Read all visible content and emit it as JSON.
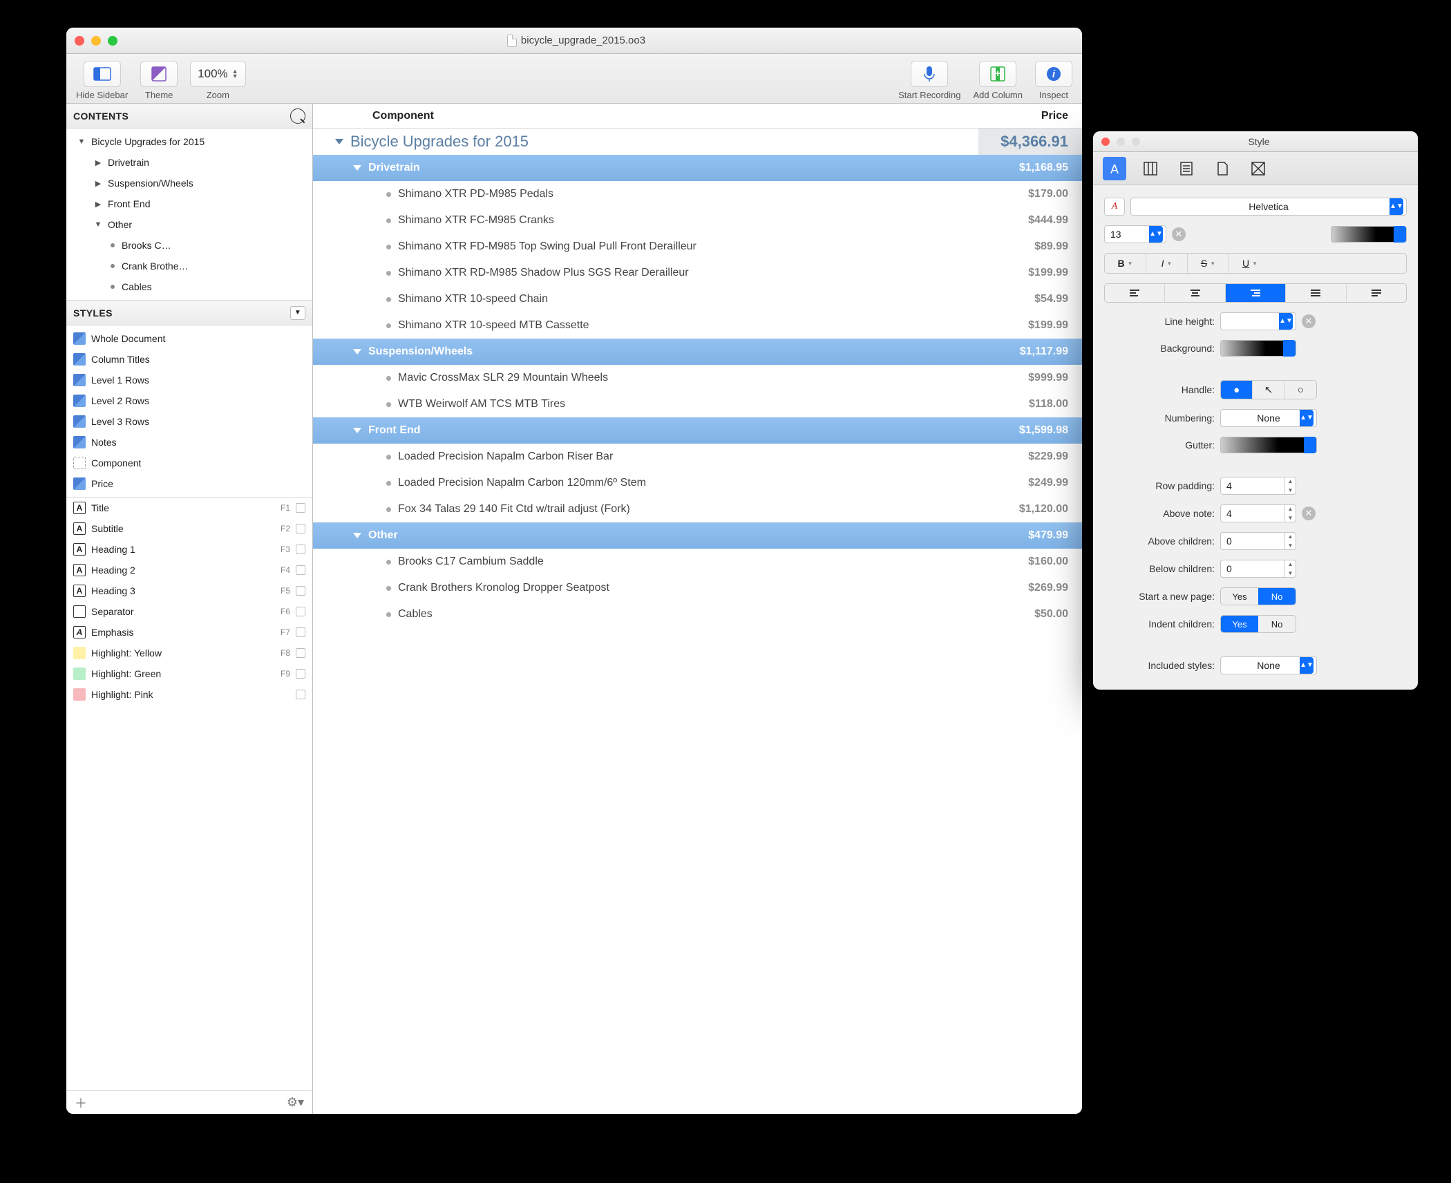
{
  "window": {
    "title": "bicycle_upgrade_2015.oo3"
  },
  "toolbar": {
    "hide_sidebar": "Hide Sidebar",
    "theme": "Theme",
    "zoom_label": "Zoom",
    "zoom_value": "100%",
    "start_recording": "Start Recording",
    "add_column": "Add Column",
    "inspect": "Inspect"
  },
  "sidebar": {
    "contents_label": "CONTENTS",
    "styles_label": "STYLES",
    "contents": [
      {
        "label": "Bicycle Upgrades for 2015",
        "indent": 0,
        "expanded": true,
        "leaf": false
      },
      {
        "label": "Drivetrain",
        "indent": 1,
        "expanded": false,
        "leaf": false
      },
      {
        "label": "Suspension/Wheels",
        "indent": 1,
        "expanded": false,
        "leaf": false
      },
      {
        "label": "Front End",
        "indent": 1,
        "expanded": false,
        "leaf": false
      },
      {
        "label": "Other",
        "indent": 1,
        "expanded": true,
        "leaf": false
      },
      {
        "label": "Brooks C…",
        "indent": 2,
        "leaf": true
      },
      {
        "label": "Crank Brothe…",
        "indent": 2,
        "leaf": true
      },
      {
        "label": "Cables",
        "indent": 2,
        "leaf": true
      }
    ],
    "styles": [
      {
        "label": "Whole Document",
        "swatch": "blue"
      },
      {
        "label": "Column Titles",
        "swatch": "blue"
      },
      {
        "label": "Level 1 Rows",
        "swatch": "blue"
      },
      {
        "label": "Level 2 Rows",
        "swatch": "blue"
      },
      {
        "label": "Level 3 Rows",
        "swatch": "blue"
      },
      {
        "label": "Notes",
        "swatch": "blue"
      },
      {
        "label": "Component",
        "swatch": "dash"
      },
      {
        "label": "Price",
        "swatch": "blue"
      }
    ],
    "named_styles": [
      {
        "label": "Title",
        "key": "F1",
        "glyph": "A"
      },
      {
        "label": "Subtitle",
        "key": "F2",
        "glyph": "A"
      },
      {
        "label": "Heading 1",
        "key": "F3",
        "glyph": "A"
      },
      {
        "label": "Heading 2",
        "key": "F4",
        "glyph": "A"
      },
      {
        "label": "Heading 3",
        "key": "F5",
        "glyph": "A"
      },
      {
        "label": "Separator",
        "key": "F6",
        "glyph": "sep"
      },
      {
        "label": "Emphasis",
        "key": "F7",
        "glyph": "Ai"
      },
      {
        "label": "Highlight: Yellow",
        "key": "F8",
        "glyph": "hl",
        "color": "#fff1a6"
      },
      {
        "label": "Highlight: Green",
        "key": "F9",
        "glyph": "hl",
        "color": "#b8efc8"
      },
      {
        "label": "Highlight: Pink",
        "key": "",
        "glyph": "hl",
        "color": "#f7b9bb"
      }
    ]
  },
  "columns": {
    "component": "Component",
    "price": "Price"
  },
  "outline": [
    {
      "level": 0,
      "label": "Bicycle Upgrades for 2015",
      "price": "$4,366.91"
    },
    {
      "level": 1,
      "label": "Drivetrain",
      "price": "$1,168.95"
    },
    {
      "level": 2,
      "label": "Shimano XTR PD-M985 Pedals",
      "price": "$179.00"
    },
    {
      "level": 2,
      "label": "Shimano XTR FC-M985 Cranks",
      "price": "$444.99"
    },
    {
      "level": 2,
      "label": "Shimano XTR FD-M985 Top Swing Dual Pull Front Derailleur",
      "price": "$89.99"
    },
    {
      "level": 2,
      "label": "Shimano XTR RD-M985 Shadow Plus SGS Rear Derailleur",
      "price": "$199.99"
    },
    {
      "level": 2,
      "label": "Shimano XTR 10-speed Chain",
      "price": "$54.99"
    },
    {
      "level": 2,
      "label": "Shimano XTR 10-speed MTB Cassette",
      "price": "$199.99"
    },
    {
      "level": 1,
      "label": "Suspension/Wheels",
      "price": "$1,117.99"
    },
    {
      "level": 2,
      "label": "Mavic CrossMax SLR 29 Mountain Wheels",
      "price": "$999.99"
    },
    {
      "level": 2,
      "label": "WTB Weirwolf AM TCS MTB Tires",
      "price": "$118.00"
    },
    {
      "level": 1,
      "label": "Front End",
      "price": "$1,599.98"
    },
    {
      "level": 2,
      "label": "Loaded Precision Napalm Carbon Riser Bar",
      "price": "$229.99"
    },
    {
      "level": 2,
      "label": "Loaded Precision Napalm Carbon 120mm/6º Stem",
      "price": "$249.99"
    },
    {
      "level": 2,
      "label": "Fox 34 Talas 29 140 Fit Ctd w/trail adjust (Fork)",
      "price": "$1,120.00"
    },
    {
      "level": 1,
      "label": "Other",
      "price": "$479.99"
    },
    {
      "level": 2,
      "label": "Brooks C17 Cambium Saddle",
      "price": "$160.00"
    },
    {
      "level": 2,
      "label": "Crank Brothers Kronolog Dropper Seatpost",
      "price": "$269.99"
    },
    {
      "level": 2,
      "label": "Cables",
      "price": "$50.00"
    }
  ],
  "inspector": {
    "title": "Style",
    "font_family": "Helvetica",
    "font_size": "13",
    "line_height_label": "Line height:",
    "background_label": "Background:",
    "handle_label": "Handle:",
    "numbering_label": "Numbering:",
    "numbering_value": "None",
    "gutter_label": "Gutter:",
    "row_padding_label": "Row padding:",
    "row_padding_value": "4",
    "above_note_label": "Above note:",
    "above_note_value": "4",
    "above_children_label": "Above children:",
    "above_children_value": "0",
    "below_children_label": "Below children:",
    "below_children_value": "0",
    "start_new_page_label": "Start a new page:",
    "indent_children_label": "Indent children:",
    "included_styles_label": "Included styles:",
    "included_styles_value": "None",
    "yes": "Yes",
    "no": "No"
  }
}
